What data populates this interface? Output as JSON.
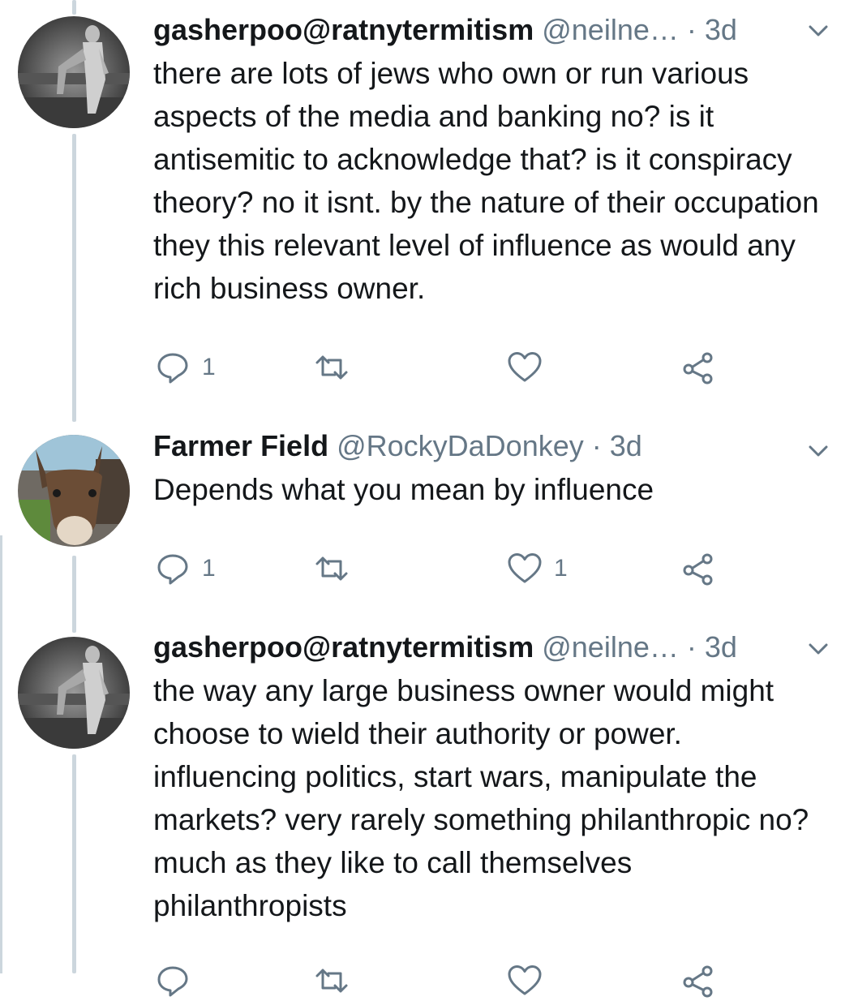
{
  "tweets": [
    {
      "display_name": "gasherpoo@ratnytermitism",
      "handle": "@neilne…",
      "separator": "·",
      "time": "3d",
      "text": "there are lots of jews who own or run various aspects of the media and banking no? is it antisemitic to acknowledge that? is it conspiracy theory? no it isnt. by the nature of their occupation they this relevant level of influence as would any rich business owner.",
      "reply_count": "1",
      "retweet_count": "",
      "like_count": "",
      "avatar_icon": "statue-avatar"
    },
    {
      "display_name": "Farmer Field",
      "handle": "@RockyDaDonkey",
      "separator": "·",
      "time": "3d",
      "text": "Depends what you mean by influence",
      "reply_count": "1",
      "retweet_count": "",
      "like_count": "1",
      "avatar_icon": "donkey-avatar"
    },
    {
      "display_name": "gasherpoo@ratnytermitism",
      "handle": "@neilne…",
      "separator": "·",
      "time": "3d",
      "text": "the way any large business owner would might choose to wield their authority or power. influencing politics, start wars, manipulate the markets? very rarely something philanthropic no? much as they like to call themselves philanthropists",
      "reply_count": "",
      "retweet_count": "",
      "like_count": "",
      "avatar_icon": "statue-avatar"
    }
  ],
  "colors": {
    "text": "#14171a",
    "secondary": "#657786",
    "thread_line": "#ccd6dd",
    "background": "#ffffff"
  },
  "icons": [
    "reply-icon",
    "retweet-icon",
    "like-icon",
    "share-icon",
    "chevron-down-icon"
  ]
}
